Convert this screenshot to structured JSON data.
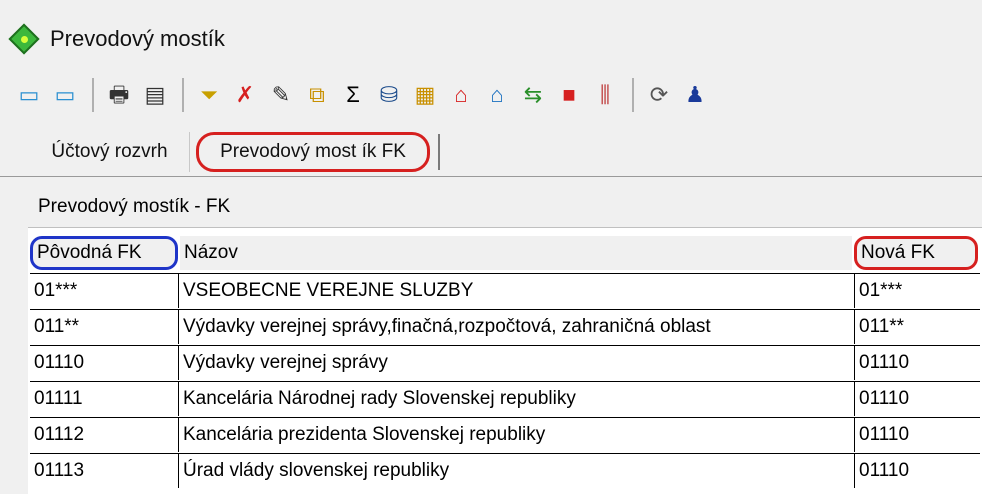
{
  "window": {
    "title": "Prevodový mostík",
    "icon": "green-diamond-icon"
  },
  "toolbar": {
    "groups": [
      [
        "window-tile-icon",
        "window-restore-icon"
      ],
      [
        "printer-icon",
        "document-icon"
      ],
      [
        "filter-icon",
        "filter-clear-icon",
        "pencil-icon",
        "copy-icon",
        "sum-icon",
        "database-icon",
        "calculator-icon",
        "house-red-icon",
        "house-blue-icon",
        "transfer-icon",
        "blocks-icon",
        "chart-icon"
      ],
      [
        "refresh-icon",
        "user-icon"
      ]
    ],
    "glyphs": {
      "window-tile-icon": "▭",
      "window-restore-icon": "▭",
      "printer-icon": "🖶",
      "document-icon": "▤",
      "filter-icon": "⏷",
      "filter-clear-icon": "✗",
      "pencil-icon": "✎",
      "copy-icon": "⧉",
      "sum-icon": "Σ",
      "database-icon": "⛁",
      "calculator-icon": "▦",
      "house-red-icon": "⌂",
      "house-blue-icon": "⌂",
      "transfer-icon": "⇆",
      "blocks-icon": "■",
      "chart-icon": "⫼",
      "refresh-icon": "⟳",
      "user-icon": "♟"
    },
    "colors": {
      "window-tile-icon": "#2a8fd0",
      "window-restore-icon": "#2a8fd0",
      "printer-icon": "#333333",
      "document-icon": "#333333",
      "filter-icon": "#c8a000",
      "filter-clear-icon": "#d62020",
      "pencil-icon": "#333333",
      "copy-icon": "#c89000",
      "sum-icon": "#000000",
      "database-icon": "#1a4a8a",
      "calculator-icon": "#c89000",
      "house-red-icon": "#d62020",
      "house-blue-icon": "#1a70c0",
      "transfer-icon": "#2a8f2a",
      "blocks-icon": "#d62020",
      "chart-icon": "#c04040",
      "refresh-icon": "#555555",
      "user-icon": "#1a3a9a"
    }
  },
  "tabs": [
    {
      "label": "Účtový rozvrh",
      "active": false
    },
    {
      "label": "Prevodový most ík FK",
      "active": true
    }
  ],
  "panel": {
    "title": "Prevodový mostík - FK"
  },
  "table": {
    "headers": {
      "povodna": "Pôvodná FK",
      "nazov": "Názov",
      "nova": "Nová FK"
    },
    "rows": [
      {
        "povodna": "01***",
        "nazov": "VSEOBECNE VEREJNE SLUZBY",
        "nova": "01***"
      },
      {
        "povodna": "011**",
        "nazov": "Výdavky verejnej správy,finačná,rozpočtová, zahraničná oblast",
        "nova": "011**"
      },
      {
        "povodna": "01110",
        "nazov": "Výdavky verejnej správy",
        "nova": "01110"
      },
      {
        "povodna": "01111",
        "nazov": "Kancelária Národnej rady Slovenskej republiky",
        "nova": "01110"
      },
      {
        "povodna": "01112",
        "nazov": "Kancelária prezidenta Slovenskej republiky",
        "nova": "01110"
      },
      {
        "povodna": "01113",
        "nazov": "Úrad vlády slovenskej republiky",
        "nova": "01110"
      }
    ]
  }
}
